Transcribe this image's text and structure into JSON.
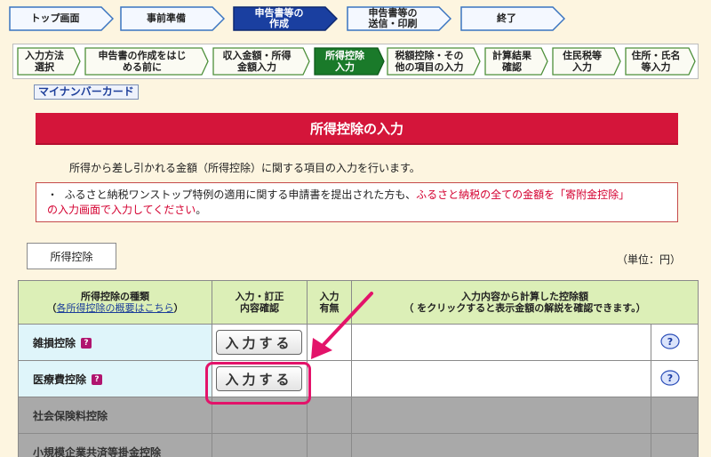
{
  "steps": [
    {
      "label": "トップ画面"
    },
    {
      "label": "事前準備"
    },
    {
      "label": "申告書等の\n作成"
    },
    {
      "label": "申告書等の\n送信・印刷"
    },
    {
      "label": "終了"
    }
  ],
  "substeps": [
    {
      "label": "入力方法\n選択"
    },
    {
      "label": "申告書の作成をはじ\nめる前に"
    },
    {
      "label": "収入金額・所得\n金額入力"
    },
    {
      "label": "所得控除\n入力"
    },
    {
      "label": "税額控除・その\n他の項目の入力"
    },
    {
      "label": "計算結果\n確認"
    },
    {
      "label": "住民税等\n入力"
    },
    {
      "label": "住所・氏名\n等入力"
    }
  ],
  "mynumber_label": "マイナンバーカード",
  "page_title": "所得控除の入力",
  "intro_text": "所得から差し引かれる金額（所得控除）に関する項目の入力を行います。",
  "notice": {
    "bullet": "・",
    "text1": "ふるさと納税ワンストップ特例の適用に関する申請書を提出された方も、",
    "text_red1": "ふるさと納税の全ての金額を「寄附金控除」",
    "text_red2": "の入力画面で入力してください",
    "text2": "。"
  },
  "tab_label": "所得控除",
  "unit_label": "（単位：円）",
  "table": {
    "headers": {
      "type": "所得控除の種類",
      "type_link": "各所得控除の概要はこちら",
      "type_paren_open": "（",
      "type_paren_close": "）",
      "entry": "入力・訂正\n内容確認",
      "has_input": "入力\n有無",
      "calc": "入力内容から計算した控除額",
      "calc_sub": "（  をクリックすると表示金額の解説を確認できます。）"
    },
    "rows": [
      {
        "name": "雑損控除",
        "button": "入力する",
        "gray": false
      },
      {
        "name": "医療費控除",
        "button": "入力する",
        "gray": false
      },
      {
        "name": "社会保険料控除",
        "gray": true
      },
      {
        "name": "小規模企業共済等掛金控除",
        "gray": true
      }
    ],
    "help_mark": "?",
    "q_mark": "?"
  },
  "colors": {
    "active_step": "#1a3fa0",
    "active_substep": "#1a7a2a",
    "title_bg": "#d4153a",
    "highlight": "#e3136a"
  }
}
